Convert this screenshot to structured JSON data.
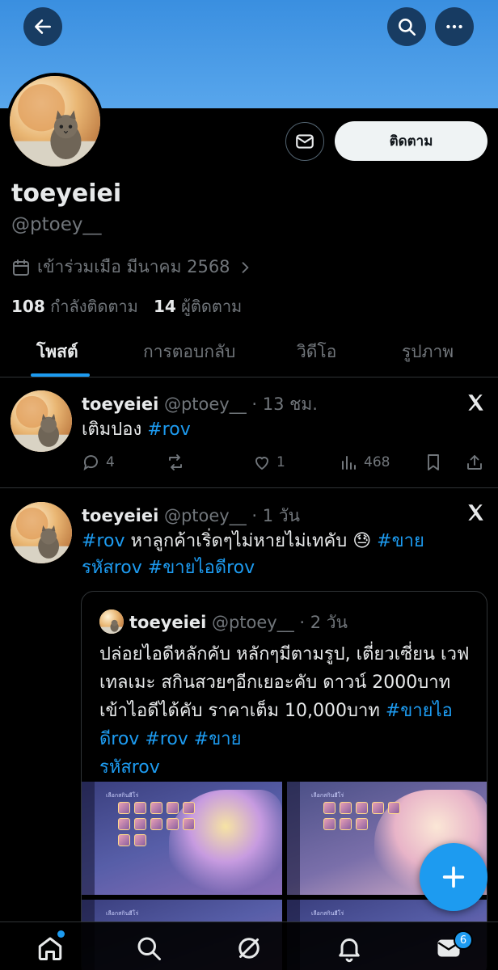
{
  "header": {
    "back_icon": "arrow-left-icon",
    "search_icon": "search-icon",
    "more_icon": "more-horizontal-icon",
    "banner_color": "#4a9be6"
  },
  "profile": {
    "display_name": "toeyeiei",
    "handle": "@ptoey__",
    "joined": "เข้าร่วมเมือ มีนาคม 2568",
    "following_count": "108",
    "following_label": "กำลังติดตาม",
    "followers_count": "14",
    "followers_label": "ผู้ติดตาม",
    "follow_button": "ติดตาม",
    "message_icon": "mail-icon"
  },
  "tabs": [
    "โพสต์",
    "การตอบกลับ",
    "วิดีโอ",
    "รูปภาพ"
  ],
  "posts": [
    {
      "name": "toeyeiei",
      "handle": "@ptoey__",
      "time": "· 13 ชม.",
      "text": "เติมปอง ",
      "tag": "#rov",
      "replies": "4",
      "likes": "1",
      "views": "468"
    },
    {
      "name": "toeyeiei",
      "handle": "@ptoey__",
      "time": "· 1 วัน",
      "tag1": "#rov",
      "text1": " หาลูกค้าเริ่ดๆไม่หายไม่เทคับ ",
      "emoji": "😓",
      "tag2": "#ขาย",
      "tag3": "รหัสrov",
      "tag4": "#ขายไอดีrov",
      "quote": {
        "name": "toeyeiei",
        "handle": "@ptoey__",
        "time": "· 2 วัน",
        "text": "ปล่อยไอดีหลักคับ หลักๆมีตามรูป, เตี่ยวเซี่ยน เวฟ เทลเมะ สกินสวยๆอีกเยอะคับ ดาวน์ 2000บาท เข้าไอดีได้คับ ราคาเต็ม 10,000บาท ",
        "tags": "#ขายไอดีrov #rov #ขาย",
        "tags2": "รหัสrov",
        "media_title": "เลือกสกินฮีโร่"
      }
    }
  ],
  "fab_icon": "plus-icon",
  "nav": {
    "home_icon": "home-icon",
    "search_icon": "search-icon",
    "grok_icon": "grok-icon",
    "notifications_icon": "bell-icon",
    "messages_icon": "mail-icon",
    "messages_badge": "6"
  }
}
